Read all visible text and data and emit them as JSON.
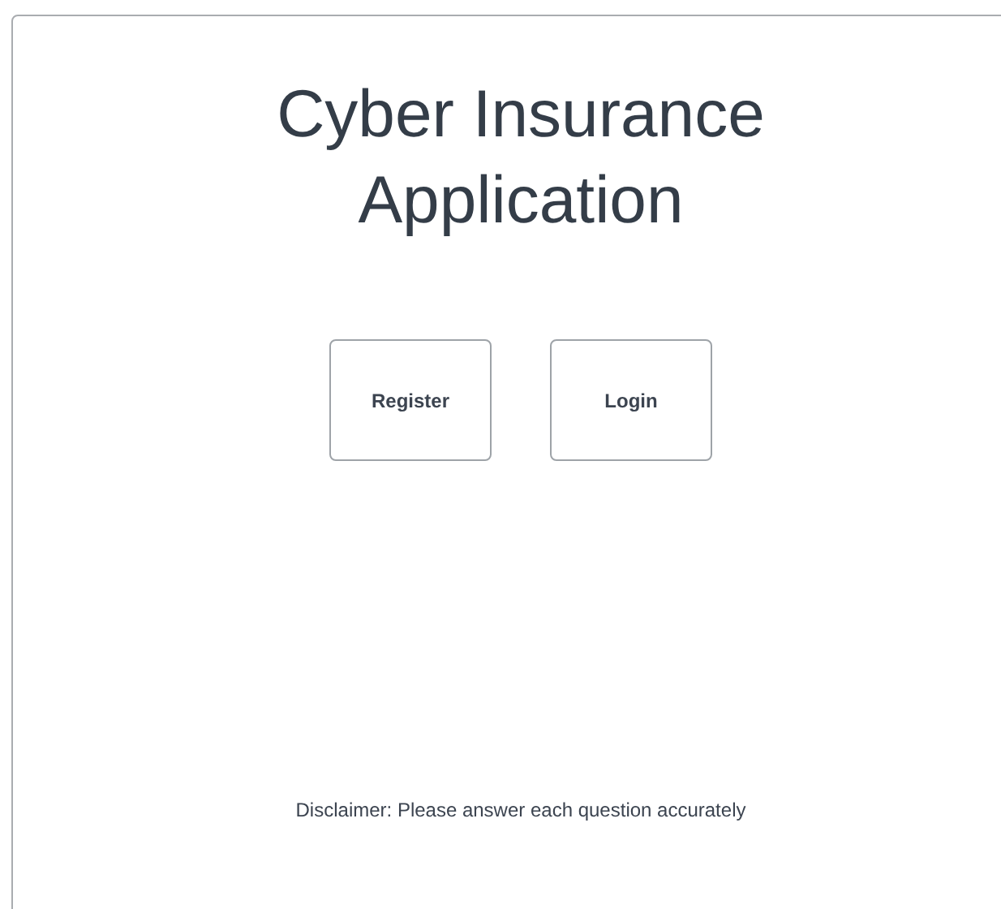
{
  "title": "Cyber Insurance Application",
  "buttons": [
    {
      "label": "Register"
    },
    {
      "label": "Login"
    }
  ],
  "disclaimer": "Disclaimer: Please answer each question accurately"
}
